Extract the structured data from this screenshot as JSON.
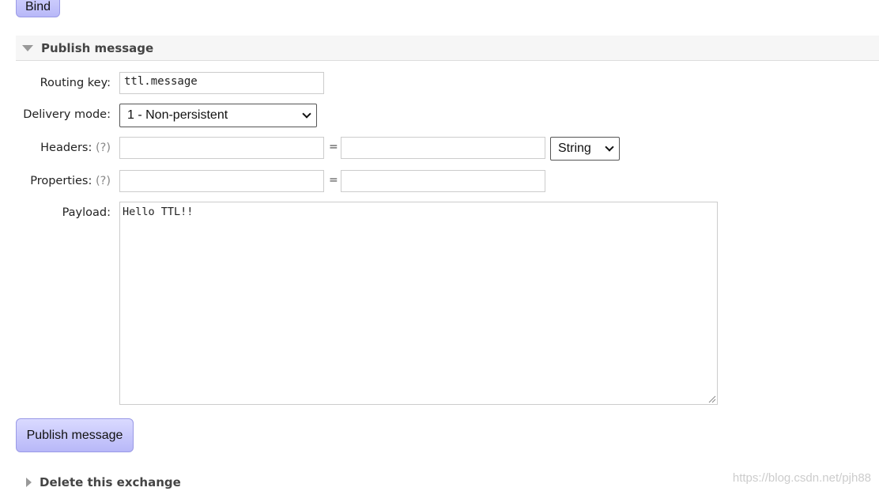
{
  "bind_button": "Bind",
  "publish_section": {
    "title": "Publish message",
    "expanded": true
  },
  "form": {
    "routing_key_label": "Routing key:",
    "routing_key_value": "ttl.message",
    "delivery_mode_label": "Delivery mode:",
    "delivery_mode_value": "1 - Non-persistent",
    "headers_label": "Headers:",
    "headers_help": "(?)",
    "headers_type_value": "String",
    "properties_label": "Properties:",
    "properties_help": "(?)",
    "equals": "=",
    "payload_label": "Payload:",
    "payload_value": "Hello TTL!!"
  },
  "publish_button": "Publish message",
  "delete_section": {
    "title": "Delete this exchange",
    "expanded": false
  },
  "watermark": "https://blog.csdn.net/pjh88"
}
